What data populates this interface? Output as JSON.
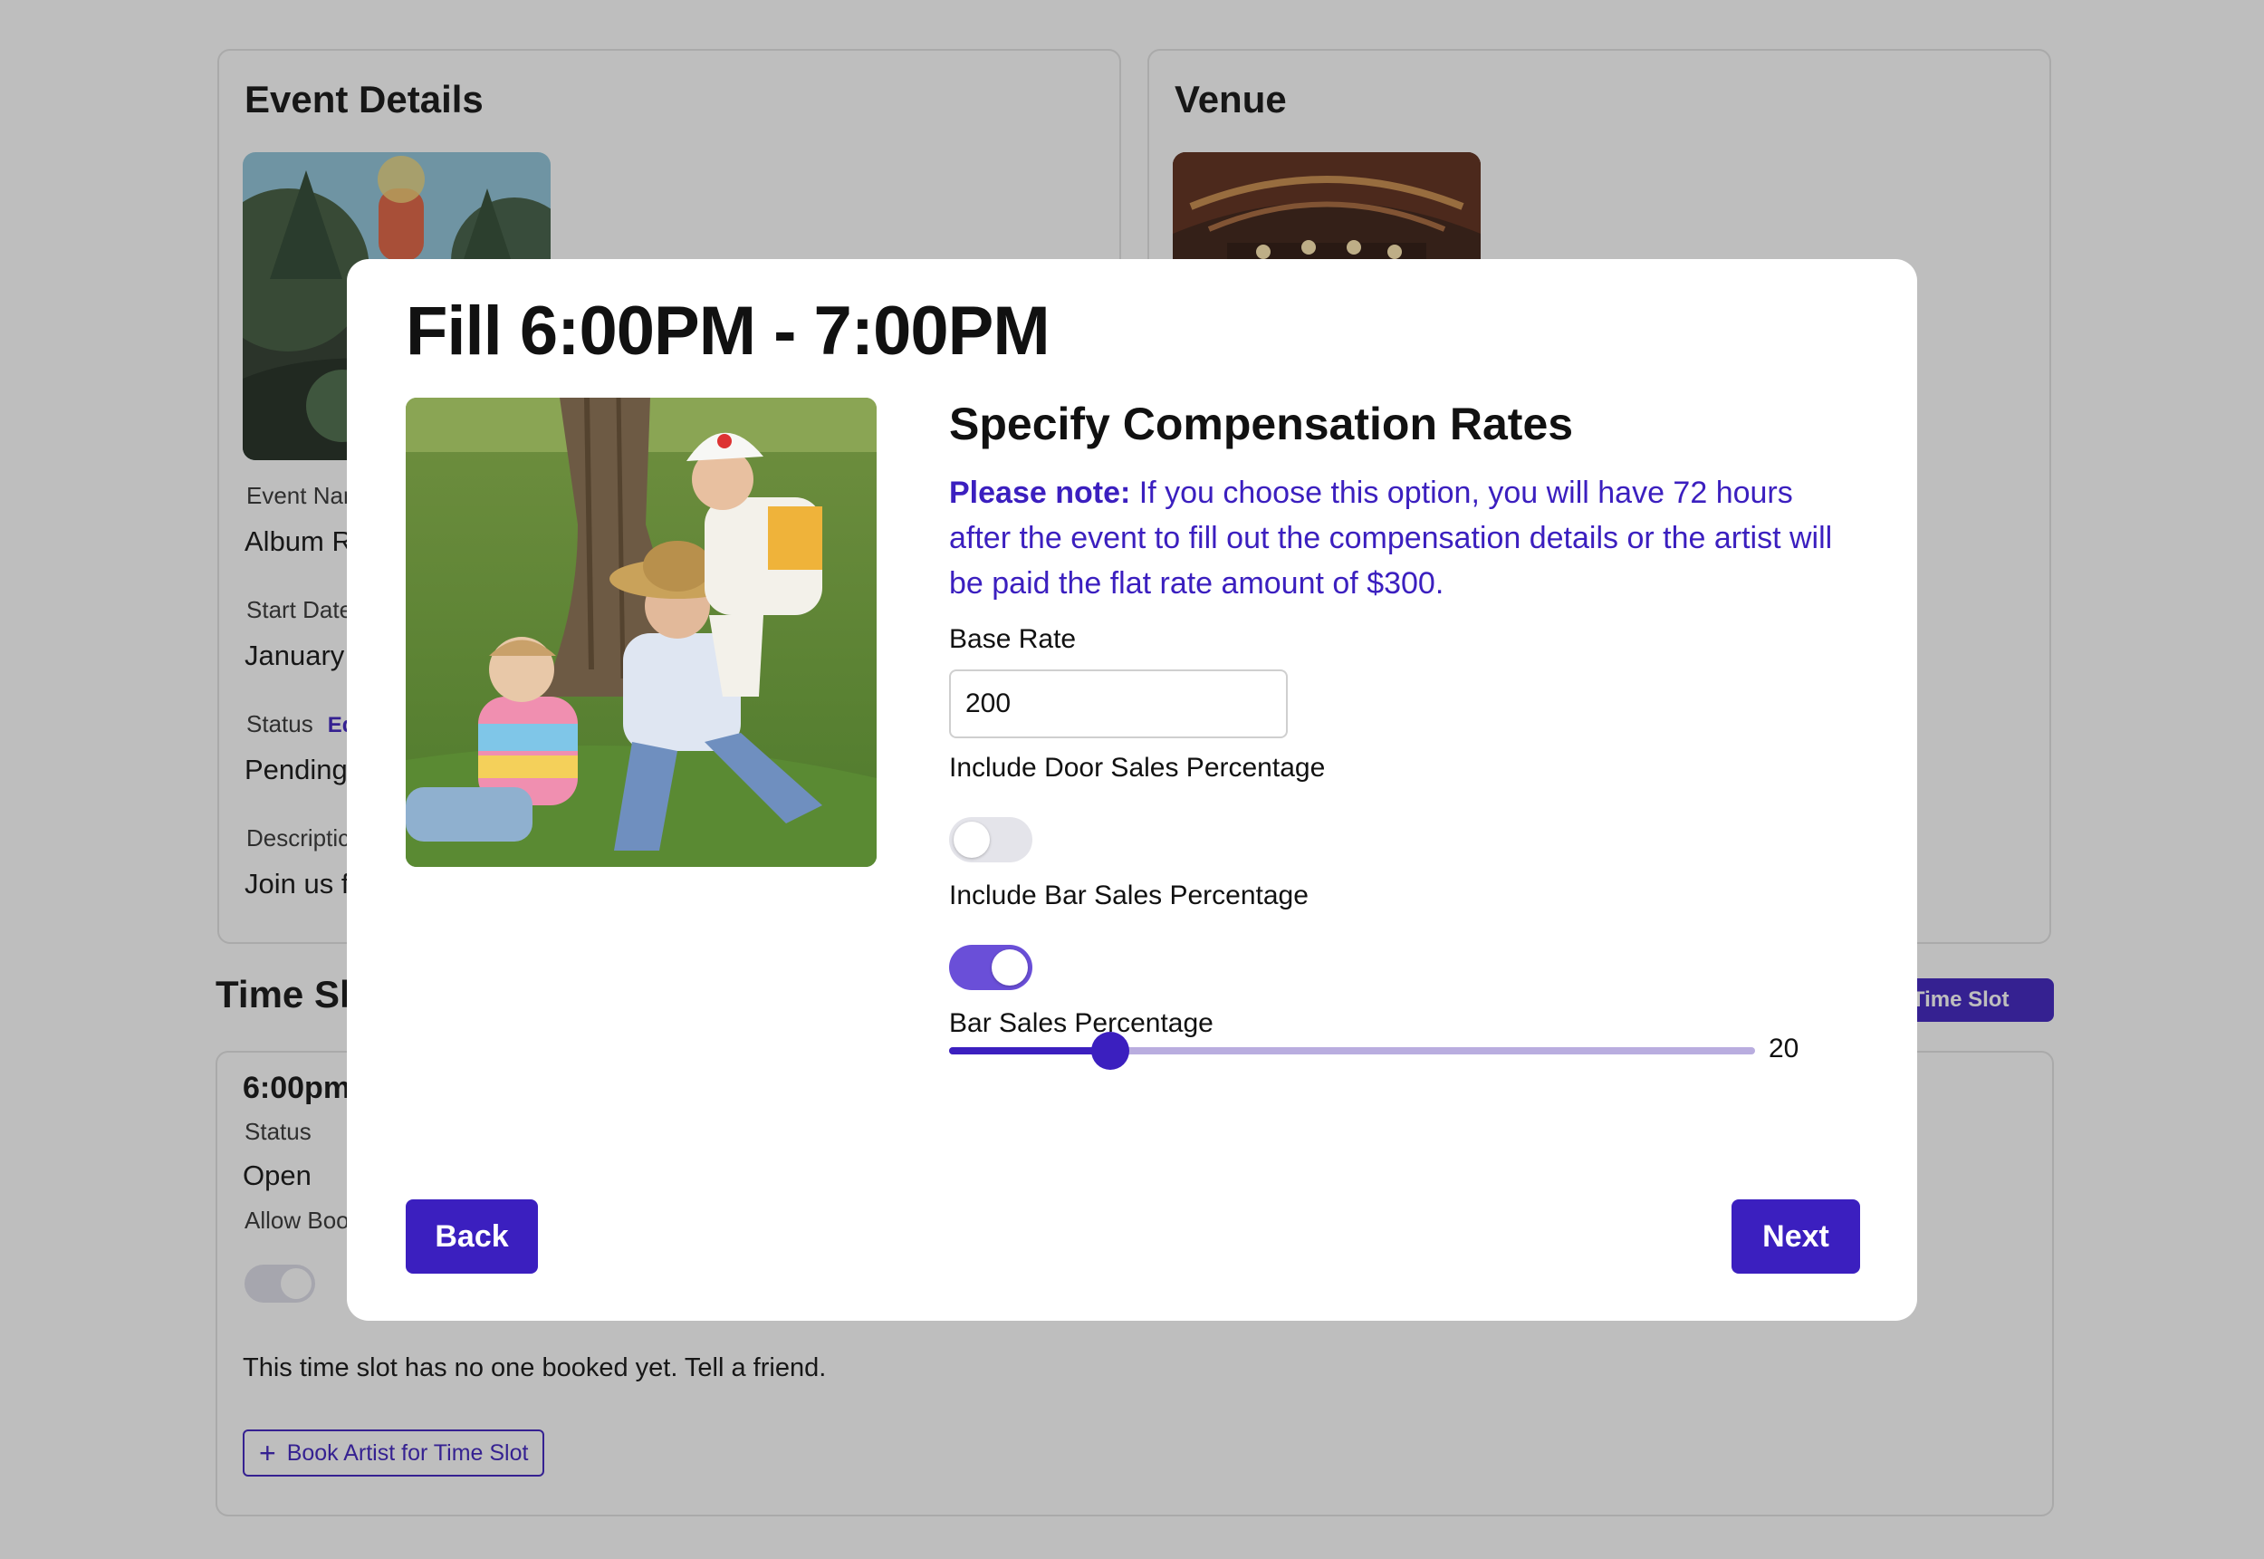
{
  "event_details": {
    "title": "Event Details",
    "event_name_label": "Event Nar",
    "event_name_value": "Album R",
    "start_date_label": "Start Date",
    "start_date_value": "January",
    "status_label": "Status",
    "status_edit": "Ed",
    "status_value": "Pending",
    "description_label": "Descriptic",
    "description_value": "Join us f"
  },
  "venue": {
    "title": "Venue"
  },
  "time_slots": {
    "title": "Time Sl",
    "add_button": "d Time Slot",
    "slot": {
      "time": "6:00pm",
      "status_label": "Status",
      "status_value": "Open",
      "allow_label": "Allow Boo",
      "empty_text": "This time slot has no one booked yet. Tell a friend.",
      "book_button": "Book Artist for Time Slot"
    }
  },
  "modal": {
    "title": "Fill 6:00PM - 7:00PM",
    "heading": "Specify Compensation Rates",
    "note_bold": "Please note:",
    "note_text": " If you choose this option, you will have 72 hours after the event to fill out the compensation details or the artist will be paid the flat rate amount of $300.",
    "base_rate_label": "Base Rate",
    "base_rate_value": "200",
    "door_sales_label": "Include Door Sales Percentage",
    "door_sales_enabled": false,
    "bar_sales_label": "Include Bar Sales Percentage",
    "bar_sales_enabled": true,
    "bar_percentage_label": "Bar Sales Percentage",
    "bar_percentage_value": "20",
    "bar_percentage_fraction": 0.2,
    "back_button": "Back",
    "next_button": "Next"
  },
  "colors": {
    "accent": "#3b1fbf",
    "toggle_on": "#6a4fd8",
    "toggle_off": "#e4e4ea",
    "overlay": "rgba(40,40,40,0.30)"
  }
}
